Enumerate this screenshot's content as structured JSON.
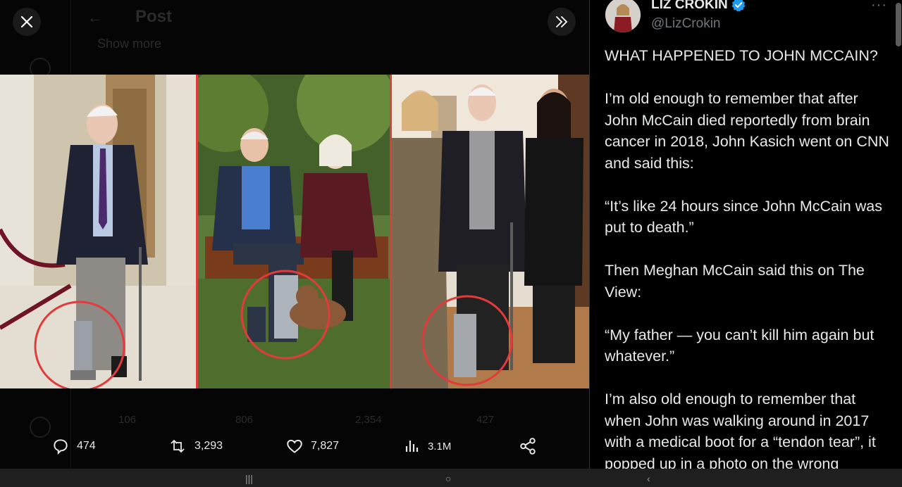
{
  "viewer": {
    "background_post": {
      "title": "Post",
      "show_more": "Show more",
      "counts": [
        "106",
        "806",
        "2,354",
        "427"
      ]
    },
    "close_icon": "close-icon",
    "expand_icon": "double-chevron-right-icon"
  },
  "actions": {
    "replies": "474",
    "reposts": "3,293",
    "likes": "7,827",
    "views": "3.1M"
  },
  "author": {
    "name": "LIZ CROKIN",
    "handle": "@LizCrokin",
    "verified_color": "#1d9bf0",
    "more": "···"
  },
  "tweet": {
    "paragraphs": [
      "WHAT HAPPENED TO JOHN MCCAIN?",
      "I’m old enough to remember that after John McCain died reportedly from brain cancer in 2018,  John Kasich went on CNN and said this:",
      "“It’s like 24 hours since John McCain was put to death.”",
      "Then Meghan McCain said this on The View:",
      "“My father — you can’t kill him again but whatever.”",
      "I’m also old enough to remember that when John was walking around in 2017 with a medical boot for a “tendon tear”, it popped up in a photo on the wrong"
    ]
  },
  "colors": {
    "accent_red": "#e23b3b",
    "text": "#e7e9ea",
    "muted": "#71767b"
  }
}
